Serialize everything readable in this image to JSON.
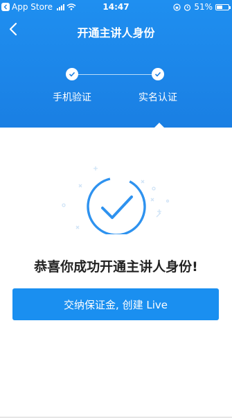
{
  "status_bar": {
    "back_app": "App Store",
    "time": "14:47",
    "battery": "51%",
    "battery_level": 0.51
  },
  "header": {
    "title": "开通主讲人身份"
  },
  "steps": [
    {
      "label": "手机验证",
      "done": true
    },
    {
      "label": "实名认证",
      "done": true
    }
  ],
  "main": {
    "message": "恭喜你成功开通主讲人身份!",
    "cta_label": "交纳保证金, 创建 Live"
  },
  "colors": {
    "brand": "#1a8ff0",
    "header_gradient_top": "#1f8ff0",
    "text_dark": "#222222"
  },
  "icons": [
    "back-chevron-icon",
    "check-icon",
    "success-check-circle-icon",
    "wifi-icon",
    "alarm-icon",
    "rotation-lock-icon"
  ]
}
